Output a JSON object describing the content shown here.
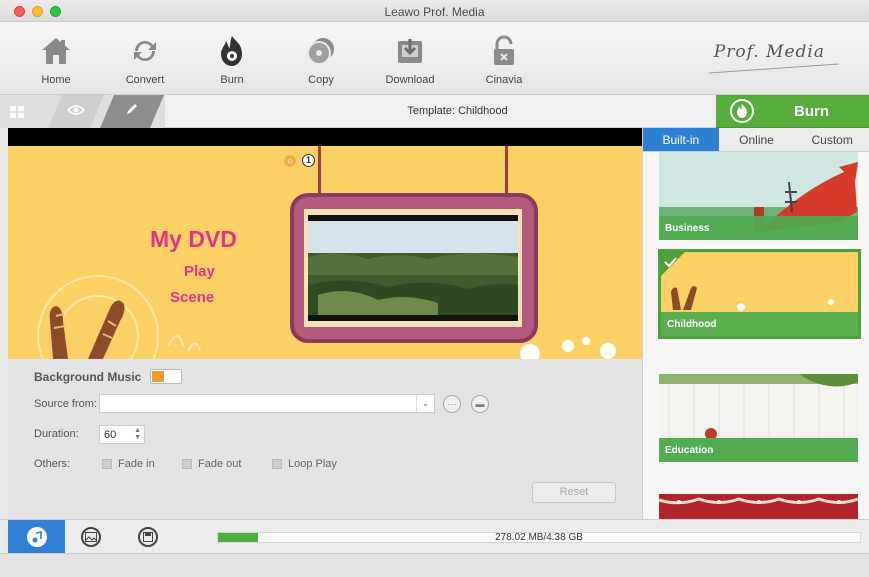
{
  "window": {
    "title": "Leawo Prof. Media"
  },
  "toolbar": {
    "items": [
      {
        "label": "Home",
        "icon": "home-icon"
      },
      {
        "label": "Convert",
        "icon": "convert-icon"
      },
      {
        "label": "Burn",
        "icon": "burn-icon"
      },
      {
        "label": "Copy",
        "icon": "copy-icon"
      },
      {
        "label": "Download",
        "icon": "download-icon"
      },
      {
        "label": "Cinavia",
        "icon": "cinavia-icon"
      }
    ],
    "brand": "Prof. Media"
  },
  "subbar": {
    "template_label": "Template: Childhood",
    "burn_label": "Burn"
  },
  "preview": {
    "title": "My DVD",
    "play": "Play",
    "scene": "Scene",
    "page_number": "1"
  },
  "settings": {
    "background_music_label": "Background Music",
    "source_label": "Source from:",
    "source_value": "",
    "duration_label": "Duration:",
    "duration_value": "60",
    "others_label": "Others:",
    "fade_in": "Fade in",
    "fade_out": "Fade out",
    "loop_play": "Loop Play",
    "reset": "Reset"
  },
  "template_panel": {
    "tabs": [
      "Built-in",
      "Online",
      "Custom"
    ],
    "active_tab": "Built-in",
    "templates": [
      {
        "name": "Business"
      },
      {
        "name": "Childhood",
        "selected": true
      },
      {
        "name": "Education"
      },
      {
        "name": ""
      }
    ]
  },
  "bottom": {
    "size_text": "278.02 MB/4.38 GB",
    "usage_fraction": 0.062
  },
  "colors": {
    "accent_green": "#57ad3b",
    "tab_blue": "#2d7fd3",
    "title_pink": "#e0368a",
    "preview_yellow": "#fbd165"
  }
}
